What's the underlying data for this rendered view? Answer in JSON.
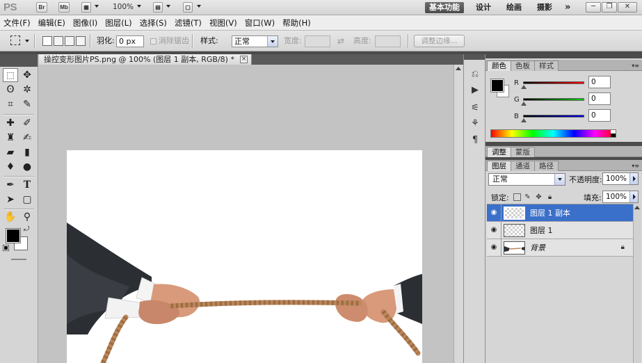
{
  "appbar": {
    "logo": "PS",
    "bridge_label": "Br",
    "minibridge_label": "Mb",
    "zoom": "100%",
    "workspaces": [
      "基本功能",
      "设计",
      "绘画",
      "摄影"
    ],
    "active_workspace": "基本功能",
    "more_label": "»"
  },
  "menubar": {
    "items": [
      "文件(F)",
      "编辑(E)",
      "图像(I)",
      "图层(L)",
      "选择(S)",
      "滤镜(T)",
      "视图(V)",
      "窗口(W)",
      "帮助(H)"
    ]
  },
  "options": {
    "feather_label": "羽化:",
    "feather_value": "0 px",
    "antialias_label": "消除锯齿",
    "style_label": "样式:",
    "style_value": "正常",
    "width_label": "宽度:",
    "height_label": "高度:",
    "refine_label": "调整边缘..."
  },
  "document": {
    "tab_title": "操控变形图片PS.png @ 100% (图层 1 副本, RGB/8) *",
    "close_glyph": "×"
  },
  "color_panel": {
    "tabs": [
      "颜色",
      "色板",
      "样式"
    ],
    "active_tab": "颜色",
    "foreground": "#000000",
    "background": "#ffffff",
    "sliders": [
      {
        "label": "R",
        "value": "0",
        "color": "#d40000"
      },
      {
        "label": "G",
        "value": "0",
        "color": "#00b000"
      },
      {
        "label": "B",
        "value": "0",
        "color": "#0000d0"
      }
    ]
  },
  "adjust_panel": {
    "tabs": [
      "调整",
      "蒙版"
    ],
    "active_tab": "调整"
  },
  "layers_panel": {
    "tabs": [
      "图层",
      "通道",
      "路径"
    ],
    "active_tab": "图层",
    "blend_mode": "正常",
    "opacity_label": "不透明度:",
    "opacity_value": "100%",
    "lock_label": "锁定:",
    "fill_label": "填充:",
    "fill_value": "100%",
    "layers": [
      {
        "name": "图层 1 副本",
        "selected": true,
        "thumb": "transparent"
      },
      {
        "name": "图层 1",
        "selected": false,
        "thumb": "transparent"
      },
      {
        "name": "背景",
        "selected": false,
        "thumb": "image",
        "italic": true,
        "locked": true
      }
    ]
  },
  "colors": {
    "accent_selected": "#3a6fca",
    "workspace_active": "#555555"
  }
}
